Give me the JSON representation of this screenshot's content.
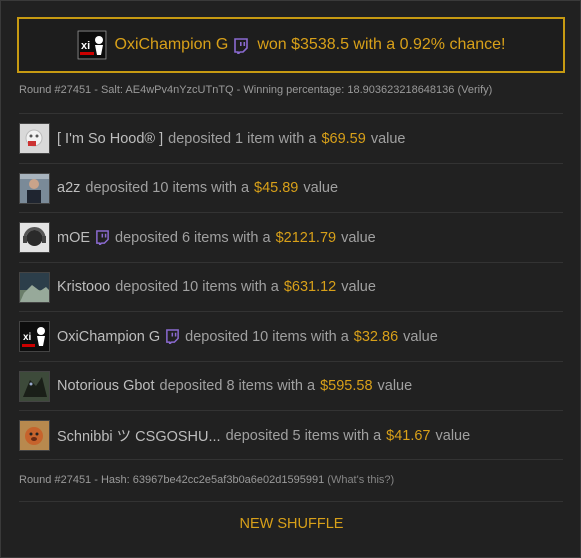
{
  "winner": {
    "name": "OxiChampion G",
    "message": "won $3538.5 with a 0.92% chance!"
  },
  "round_info": {
    "text": "Round #27451 - Salt: AE4wPv4nYzcUTnTQ - Winning percentage: 18.903623218648136",
    "verify_label": "(Verify)"
  },
  "deposits": [
    {
      "name": "[ I'm So Hood® ]",
      "mid": "deposited 1 item with a",
      "amount": "$69.59",
      "tail": "value",
      "twitch": false,
      "avatar": "mask-avatar"
    },
    {
      "name": "a2z",
      "mid": "deposited 10 items with a",
      "amount": "$45.89",
      "tail": "value",
      "twitch": false,
      "avatar": "player-avatar"
    },
    {
      "name": "mOE",
      "mid": "deposited 6 items with a",
      "amount": "$2121.79",
      "tail": "value",
      "twitch": true,
      "avatar": "headset-avatar"
    },
    {
      "name": "Kristooo",
      "mid": "deposited 10 items with a",
      "amount": "$631.12",
      "tail": "value",
      "twitch": false,
      "avatar": "landscape-avatar"
    },
    {
      "name": "OxiChampion G",
      "mid": "deposited 10 items with a",
      "amount": "$32.86",
      "tail": "value",
      "twitch": true,
      "avatar": "oxi-avatar"
    },
    {
      "name": "Notorious Gbot",
      "mid": "deposited 8 items with a",
      "amount": "$595.58",
      "tail": "value",
      "twitch": false,
      "avatar": "creature-avatar"
    },
    {
      "name": "Schnibbi ツ CSGOSHU...",
      "mid": "deposited 5 items with a",
      "amount": "$41.67",
      "tail": "value",
      "twitch": false,
      "avatar": "dog-avatar"
    }
  ],
  "hash_info": {
    "text": "Round #27451 - Hash: 63967be42cc2e5af3b0a6e02d1595991",
    "whats_this": "(What's this?)"
  },
  "shuffle_label": "NEW SHUFFLE",
  "colors": {
    "accent": "#d8a019",
    "background": "#212121",
    "twitch": "#6441a5"
  }
}
